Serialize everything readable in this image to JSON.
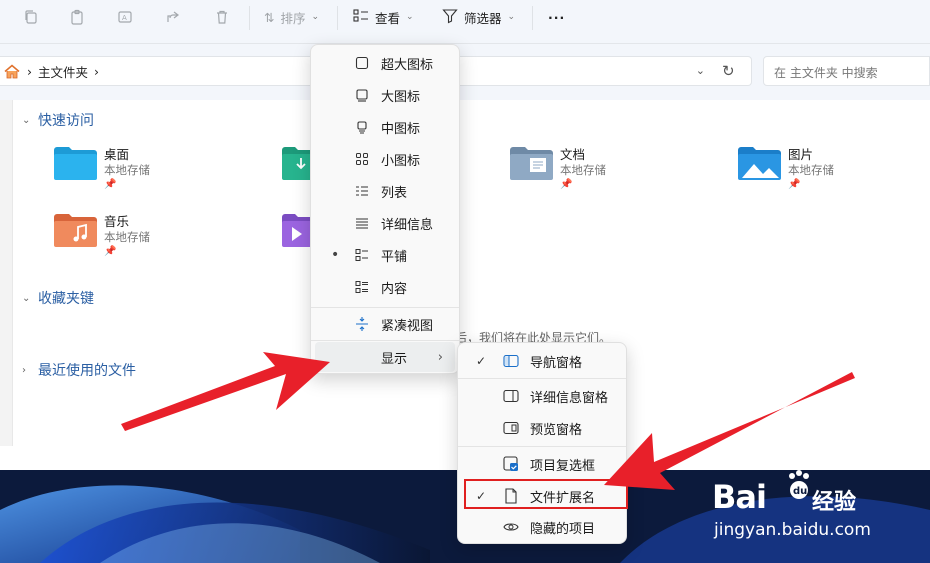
{
  "toolbar": {
    "sort_label": "排序",
    "view_label": "查看",
    "filter_label": "筛选器",
    "more_label": "···"
  },
  "address": {
    "path_segment": "主文件夹",
    "path_sep": "›",
    "search_placeholder": "在 主文件夹 中搜索"
  },
  "sections": {
    "quick_access": "快速访问",
    "favorites": "收藏夹键",
    "recent": "最近使用的文件"
  },
  "folders": [
    {
      "name": "桌面",
      "sub": "本地存储",
      "icon": "desktop-folder-icon"
    },
    {
      "name": "文档",
      "sub": "本地存储",
      "icon": "documents-folder-icon"
    },
    {
      "name": "图片",
      "sub": "本地存储",
      "icon": "pictures-folder-icon"
    },
    {
      "name": "音乐",
      "sub": "本地存储",
      "icon": "music-folder-icon"
    }
  ],
  "empty_note": "后，我们将在此处显示它们。",
  "view_menu": {
    "items": [
      {
        "label": "超大图标",
        "icon": "extra-large-icons-icon"
      },
      {
        "label": "大图标",
        "icon": "large-icons-icon"
      },
      {
        "label": "中图标",
        "icon": "medium-icons-icon"
      },
      {
        "label": "小图标",
        "icon": "small-icons-icon"
      },
      {
        "label": "列表",
        "icon": "list-icon"
      },
      {
        "label": "详细信息",
        "icon": "details-icon"
      },
      {
        "label": "平铺",
        "icon": "tiles-icon",
        "selected": true
      },
      {
        "label": "内容",
        "icon": "content-icon"
      }
    ],
    "compact_label": "紧凑视图",
    "show_label": "显示"
  },
  "show_submenu": {
    "items": [
      {
        "label": "导航窗格",
        "checked": true,
        "icon": "navigation-pane-icon"
      },
      {
        "label": "详细信息窗格",
        "checked": false,
        "icon": "details-pane-icon"
      },
      {
        "label": "预览窗格",
        "checked": false,
        "icon": "preview-pane-icon"
      },
      {
        "label": "项目复选框",
        "checked": false,
        "icon": "item-checkboxes-icon"
      },
      {
        "label": "文件扩展名",
        "checked": true,
        "icon": "file-extensions-icon"
      },
      {
        "label": "隐藏的项目",
        "checked": false,
        "icon": "hidden-items-icon"
      }
    ]
  },
  "watermark": {
    "brand": "Bai",
    "brand2": "du",
    "cn": "经验",
    "url": "jingyan.baidu.com"
  },
  "colors": {
    "accent": "#2b5fa3",
    "highlight": "#e02020",
    "arrow": "#e8202a"
  }
}
